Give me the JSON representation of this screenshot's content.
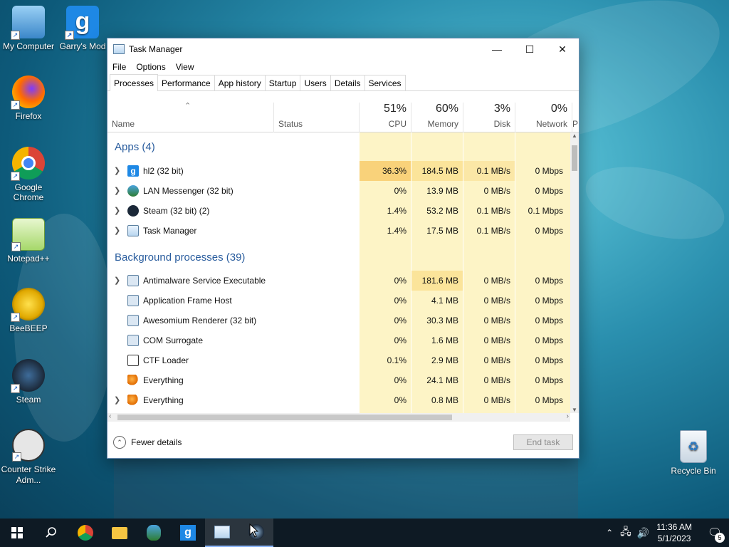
{
  "desktop": {
    "icons": [
      {
        "label": "My Computer",
        "icon": "computer-icon"
      },
      {
        "label": "Garry's Mod",
        "icon": "garrys-mod-icon"
      },
      {
        "label": "Firefox",
        "icon": "firefox-icon"
      },
      {
        "label": "Google Chrome",
        "icon": "chrome-icon"
      },
      {
        "label": "Notepad++",
        "icon": "notepad-plus-plus-icon"
      },
      {
        "label": "BeeBEEP",
        "icon": "beebeep-icon"
      },
      {
        "label": "Steam",
        "icon": "steam-icon"
      },
      {
        "label": "Counter Strike Adm...",
        "icon": "counter-strike-icon"
      },
      {
        "label": "Recycle Bin",
        "icon": "recycle-bin-icon"
      }
    ]
  },
  "window": {
    "title": "Task Manager",
    "menu": [
      "File",
      "Options",
      "View"
    ],
    "tabs": [
      "Processes",
      "Performance",
      "App history",
      "Startup",
      "Users",
      "Details",
      "Services"
    ],
    "active_tab": "Processes"
  },
  "columns": {
    "name": "Name",
    "status": "Status",
    "cpu": {
      "pct": "51%",
      "label": "CPU"
    },
    "memory": {
      "pct": "60%",
      "label": "Memory"
    },
    "disk": {
      "pct": "3%",
      "label": "Disk"
    },
    "network": {
      "pct": "0%",
      "label": "Network"
    },
    "extra": "P"
  },
  "groups": {
    "apps": "Apps (4)",
    "background": "Background processes (39)"
  },
  "apps": [
    {
      "name": "hl2 (32 bit)",
      "cpu": "36.3%",
      "mem": "184.5 MB",
      "disk": "0.1 MB/s",
      "net": "0 Mbps"
    },
    {
      "name": "LAN Messenger (32 bit)",
      "cpu": "0%",
      "mem": "13.9 MB",
      "disk": "0 MB/s",
      "net": "0 Mbps"
    },
    {
      "name": "Steam (32 bit) (2)",
      "cpu": "1.4%",
      "mem": "53.2 MB",
      "disk": "0.1 MB/s",
      "net": "0.1 Mbps"
    },
    {
      "name": "Task Manager",
      "cpu": "1.4%",
      "mem": "17.5 MB",
      "disk": "0.1 MB/s",
      "net": "0 Mbps"
    }
  ],
  "background": [
    {
      "name": "Antimalware Service Executable",
      "cpu": "0%",
      "mem": "181.6 MB",
      "disk": "0 MB/s",
      "net": "0 Mbps"
    },
    {
      "name": "Application Frame Host",
      "cpu": "0%",
      "mem": "4.1 MB",
      "disk": "0 MB/s",
      "net": "0 Mbps"
    },
    {
      "name": "Awesomium Renderer (32 bit)",
      "cpu": "0%",
      "mem": "30.3 MB",
      "disk": "0 MB/s",
      "net": "0 Mbps"
    },
    {
      "name": "COM Surrogate",
      "cpu": "0%",
      "mem": "1.6 MB",
      "disk": "0 MB/s",
      "net": "0 Mbps"
    },
    {
      "name": "CTF Loader",
      "cpu": "0.1%",
      "mem": "2.9 MB",
      "disk": "0 MB/s",
      "net": "0 Mbps"
    },
    {
      "name": "Everything",
      "cpu": "0%",
      "mem": "24.1 MB",
      "disk": "0 MB/s",
      "net": "0 Mbps"
    },
    {
      "name": "Everything",
      "cpu": "0%",
      "mem": "0.8 MB",
      "disk": "0 MB/s",
      "net": "0 Mbps"
    }
  ],
  "footer": {
    "fewer_details": "Fewer details",
    "end_task": "End task"
  },
  "clock": {
    "time": "11:36 AM",
    "date": "5/1/2023"
  },
  "notifications": "5"
}
